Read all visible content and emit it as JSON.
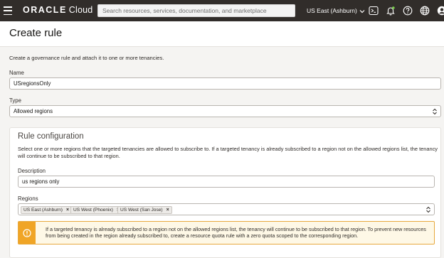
{
  "topbar": {
    "brand_primary": "ORACLE",
    "brand_secondary": "Cloud",
    "search_placeholder": "Search resources, services, documentation, and marketplace",
    "region_label": "US East (Ashburn)",
    "icons": [
      "menu-icon",
      "terminal-icon",
      "bell-icon",
      "help-icon",
      "globe-icon",
      "user-icon"
    ]
  },
  "page": {
    "title": "Create rule",
    "intro": "Create a governance rule and attach it to one or more tenancies."
  },
  "form": {
    "name_label": "Name",
    "name_value": "USregionsOnly",
    "type_label": "Type",
    "type_value": "Allowed regions"
  },
  "rule_config": {
    "title": "Rule configuration",
    "description": "Select one or more regions that the targeted tenancies are allowed to subscribe to. If a targeted tenancy is already subscribed to a region not on the allowed regions list, the tenancy will continue to be subscribed to that region.",
    "description_label": "Description",
    "description_value": "us regions only",
    "regions_label": "Regions",
    "regions": [
      {
        "label": "US East (Ashburn)",
        "remove": "×"
      },
      {
        "label": "US West (Phoenix)",
        "remove": "×"
      },
      {
        "label": "US West (San Jose)",
        "remove": "×"
      }
    ],
    "warning": "If a targeted tenancy is already subscribed to a region not on the allowed regions list, the tenancy will continue to be subscribed to that region. To prevent new resources from being created in the region already subscribed to, create a resource quota rule with a zero quota scoped to the corresponding region."
  },
  "colors": {
    "topbar": "#312d2a",
    "warning_accent": "#f0a526",
    "warning_bg": "#fef8e6"
  }
}
